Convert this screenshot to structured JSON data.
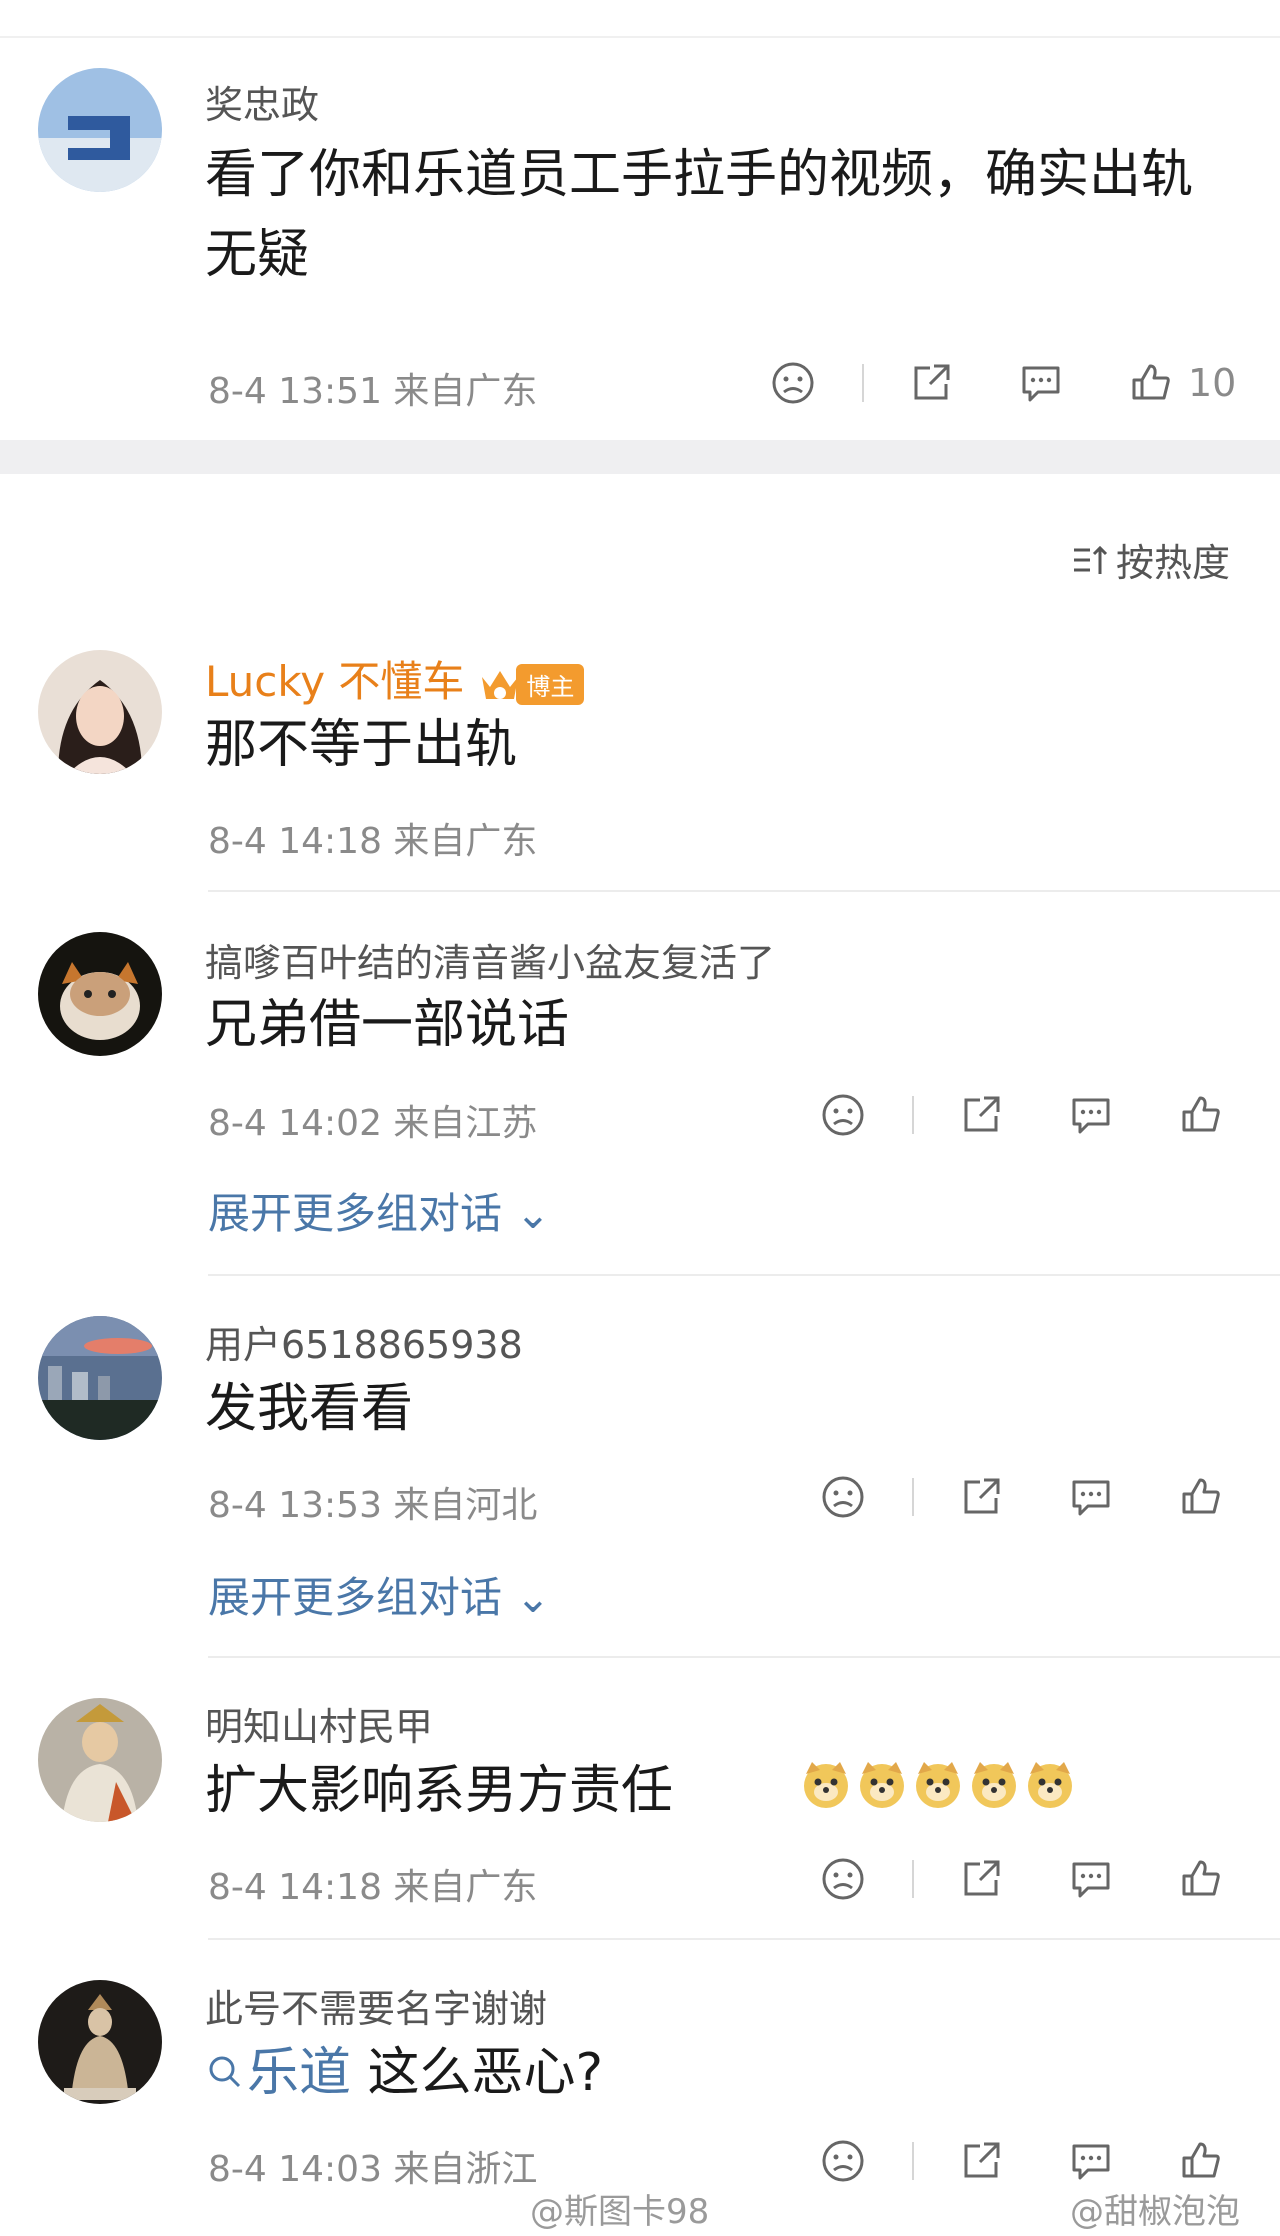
{
  "first_comment": {
    "username": "奖忠政",
    "text_line1": "看了你和乐道员工手拉手的视频，确实出轨",
    "text_line2": "无疑",
    "meta": "8-4 13:51  来自广东",
    "like_count": "10"
  },
  "sort": {
    "label": "按热度"
  },
  "comments": [
    {
      "username": "Lucky 不懂车",
      "badge": "博主",
      "text": "那不等于出轨",
      "meta": "8-4 14:18  来自广东"
    },
    {
      "username": "搞嗲百叶结的清音酱小盆友复活了",
      "text": "兄弟借一部说话",
      "meta": "8-4 14:02  来自江苏",
      "expand": "展开更多组对话"
    },
    {
      "username": "用户6518865938",
      "text": "发我看看",
      "meta": "8-4 13:53  来自河北",
      "expand": "展开更多组对话"
    },
    {
      "username": "明知山村民甲",
      "text": "扩大影响系男方责任",
      "meta": "8-4 14:18  来自广东"
    },
    {
      "username": "此号不需要名字谢谢",
      "search_term": "乐道",
      "text": " 这么恶心?",
      "meta": "8-4 14:03  来自浙江"
    }
  ],
  "watermarks": {
    "left": "@斯图卡98",
    "right": "@甜椒泡泡"
  },
  "colors": {
    "username_orange": "#e8801a",
    "link_blue": "#4a77a8",
    "meta_gray": "#8a8a8a"
  }
}
